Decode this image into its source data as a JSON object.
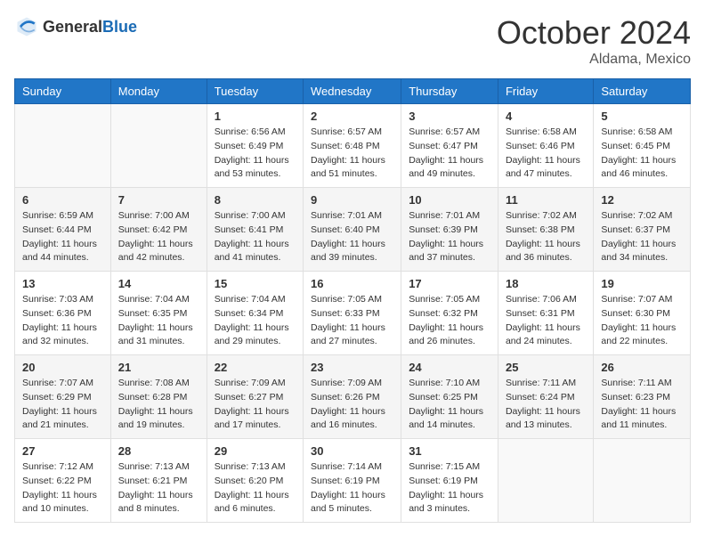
{
  "logo": {
    "general": "General",
    "blue": "Blue"
  },
  "title": "October 2024",
  "location": "Aldama, Mexico",
  "days_of_week": [
    "Sunday",
    "Monday",
    "Tuesday",
    "Wednesday",
    "Thursday",
    "Friday",
    "Saturday"
  ],
  "weeks": [
    [
      {
        "day": "",
        "sunrise": "",
        "sunset": "",
        "daylight": ""
      },
      {
        "day": "",
        "sunrise": "",
        "sunset": "",
        "daylight": ""
      },
      {
        "day": "1",
        "sunrise": "Sunrise: 6:56 AM",
        "sunset": "Sunset: 6:49 PM",
        "daylight": "Daylight: 11 hours and 53 minutes."
      },
      {
        "day": "2",
        "sunrise": "Sunrise: 6:57 AM",
        "sunset": "Sunset: 6:48 PM",
        "daylight": "Daylight: 11 hours and 51 minutes."
      },
      {
        "day": "3",
        "sunrise": "Sunrise: 6:57 AM",
        "sunset": "Sunset: 6:47 PM",
        "daylight": "Daylight: 11 hours and 49 minutes."
      },
      {
        "day": "4",
        "sunrise": "Sunrise: 6:58 AM",
        "sunset": "Sunset: 6:46 PM",
        "daylight": "Daylight: 11 hours and 47 minutes."
      },
      {
        "day": "5",
        "sunrise": "Sunrise: 6:58 AM",
        "sunset": "Sunset: 6:45 PM",
        "daylight": "Daylight: 11 hours and 46 minutes."
      }
    ],
    [
      {
        "day": "6",
        "sunrise": "Sunrise: 6:59 AM",
        "sunset": "Sunset: 6:44 PM",
        "daylight": "Daylight: 11 hours and 44 minutes."
      },
      {
        "day": "7",
        "sunrise": "Sunrise: 7:00 AM",
        "sunset": "Sunset: 6:42 PM",
        "daylight": "Daylight: 11 hours and 42 minutes."
      },
      {
        "day": "8",
        "sunrise": "Sunrise: 7:00 AM",
        "sunset": "Sunset: 6:41 PM",
        "daylight": "Daylight: 11 hours and 41 minutes."
      },
      {
        "day": "9",
        "sunrise": "Sunrise: 7:01 AM",
        "sunset": "Sunset: 6:40 PM",
        "daylight": "Daylight: 11 hours and 39 minutes."
      },
      {
        "day": "10",
        "sunrise": "Sunrise: 7:01 AM",
        "sunset": "Sunset: 6:39 PM",
        "daylight": "Daylight: 11 hours and 37 minutes."
      },
      {
        "day": "11",
        "sunrise": "Sunrise: 7:02 AM",
        "sunset": "Sunset: 6:38 PM",
        "daylight": "Daylight: 11 hours and 36 minutes."
      },
      {
        "day": "12",
        "sunrise": "Sunrise: 7:02 AM",
        "sunset": "Sunset: 6:37 PM",
        "daylight": "Daylight: 11 hours and 34 minutes."
      }
    ],
    [
      {
        "day": "13",
        "sunrise": "Sunrise: 7:03 AM",
        "sunset": "Sunset: 6:36 PM",
        "daylight": "Daylight: 11 hours and 32 minutes."
      },
      {
        "day": "14",
        "sunrise": "Sunrise: 7:04 AM",
        "sunset": "Sunset: 6:35 PM",
        "daylight": "Daylight: 11 hours and 31 minutes."
      },
      {
        "day": "15",
        "sunrise": "Sunrise: 7:04 AM",
        "sunset": "Sunset: 6:34 PM",
        "daylight": "Daylight: 11 hours and 29 minutes."
      },
      {
        "day": "16",
        "sunrise": "Sunrise: 7:05 AM",
        "sunset": "Sunset: 6:33 PM",
        "daylight": "Daylight: 11 hours and 27 minutes."
      },
      {
        "day": "17",
        "sunrise": "Sunrise: 7:05 AM",
        "sunset": "Sunset: 6:32 PM",
        "daylight": "Daylight: 11 hours and 26 minutes."
      },
      {
        "day": "18",
        "sunrise": "Sunrise: 7:06 AM",
        "sunset": "Sunset: 6:31 PM",
        "daylight": "Daylight: 11 hours and 24 minutes."
      },
      {
        "day": "19",
        "sunrise": "Sunrise: 7:07 AM",
        "sunset": "Sunset: 6:30 PM",
        "daylight": "Daylight: 11 hours and 22 minutes."
      }
    ],
    [
      {
        "day": "20",
        "sunrise": "Sunrise: 7:07 AM",
        "sunset": "Sunset: 6:29 PM",
        "daylight": "Daylight: 11 hours and 21 minutes."
      },
      {
        "day": "21",
        "sunrise": "Sunrise: 7:08 AM",
        "sunset": "Sunset: 6:28 PM",
        "daylight": "Daylight: 11 hours and 19 minutes."
      },
      {
        "day": "22",
        "sunrise": "Sunrise: 7:09 AM",
        "sunset": "Sunset: 6:27 PM",
        "daylight": "Daylight: 11 hours and 17 minutes."
      },
      {
        "day": "23",
        "sunrise": "Sunrise: 7:09 AM",
        "sunset": "Sunset: 6:26 PM",
        "daylight": "Daylight: 11 hours and 16 minutes."
      },
      {
        "day": "24",
        "sunrise": "Sunrise: 7:10 AM",
        "sunset": "Sunset: 6:25 PM",
        "daylight": "Daylight: 11 hours and 14 minutes."
      },
      {
        "day": "25",
        "sunrise": "Sunrise: 7:11 AM",
        "sunset": "Sunset: 6:24 PM",
        "daylight": "Daylight: 11 hours and 13 minutes."
      },
      {
        "day": "26",
        "sunrise": "Sunrise: 7:11 AM",
        "sunset": "Sunset: 6:23 PM",
        "daylight": "Daylight: 11 hours and 11 minutes."
      }
    ],
    [
      {
        "day": "27",
        "sunrise": "Sunrise: 7:12 AM",
        "sunset": "Sunset: 6:22 PM",
        "daylight": "Daylight: 11 hours and 10 minutes."
      },
      {
        "day": "28",
        "sunrise": "Sunrise: 7:13 AM",
        "sunset": "Sunset: 6:21 PM",
        "daylight": "Daylight: 11 hours and 8 minutes."
      },
      {
        "day": "29",
        "sunrise": "Sunrise: 7:13 AM",
        "sunset": "Sunset: 6:20 PM",
        "daylight": "Daylight: 11 hours and 6 minutes."
      },
      {
        "day": "30",
        "sunrise": "Sunrise: 7:14 AM",
        "sunset": "Sunset: 6:19 PM",
        "daylight": "Daylight: 11 hours and 5 minutes."
      },
      {
        "day": "31",
        "sunrise": "Sunrise: 7:15 AM",
        "sunset": "Sunset: 6:19 PM",
        "daylight": "Daylight: 11 hours and 3 minutes."
      },
      {
        "day": "",
        "sunrise": "",
        "sunset": "",
        "daylight": ""
      },
      {
        "day": "",
        "sunrise": "",
        "sunset": "",
        "daylight": ""
      }
    ]
  ]
}
